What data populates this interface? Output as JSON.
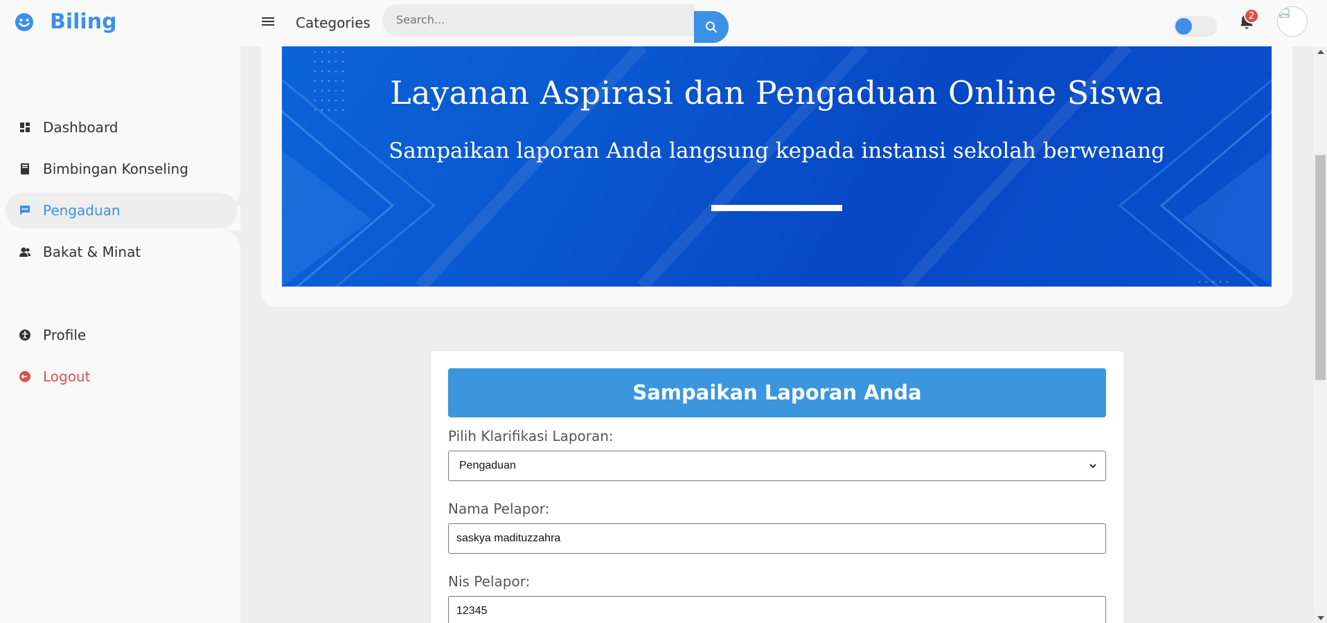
{
  "brand": {
    "name": "Biling",
    "icon": "smile-icon"
  },
  "topbar": {
    "menu_icon": "hamburger-icon",
    "categories_label": "Categories",
    "search_placeholder": "Search...",
    "search_icon": "search-icon",
    "notification_count": "2",
    "accent_color": "#3c91e6",
    "badge_color": "#db504a"
  },
  "sidebar": {
    "items": [
      {
        "label": "Dashboard",
        "icon": "dashboard-icon"
      },
      {
        "label": "Bimbingan Konseling",
        "icon": "book-icon"
      },
      {
        "label": "Pengaduan",
        "icon": "message-icon",
        "active": true
      },
      {
        "label": "Bakat & Minat",
        "icon": "group-icon"
      },
      {
        "label": "Profile",
        "icon": "accessibility-icon"
      },
      {
        "label": "Logout",
        "icon": "logout-icon"
      }
    ]
  },
  "banner": {
    "title": "Layanan Aspirasi dan Pengaduan Online Siswa",
    "subtitle": "Sampaikan laporan Anda langsung kepada instansi sekolah berwenang"
  },
  "form": {
    "header": "Sampaikan Laporan Anda",
    "fields": [
      {
        "label": "Pilih Klarifikasi Laporan:",
        "value": "Pengaduan",
        "type": "select"
      },
      {
        "label": "Nama Pelapor:",
        "value": "saskya madituzzahra",
        "type": "text"
      },
      {
        "label": "Nis Pelapor:",
        "value": "12345",
        "type": "text"
      }
    ]
  }
}
